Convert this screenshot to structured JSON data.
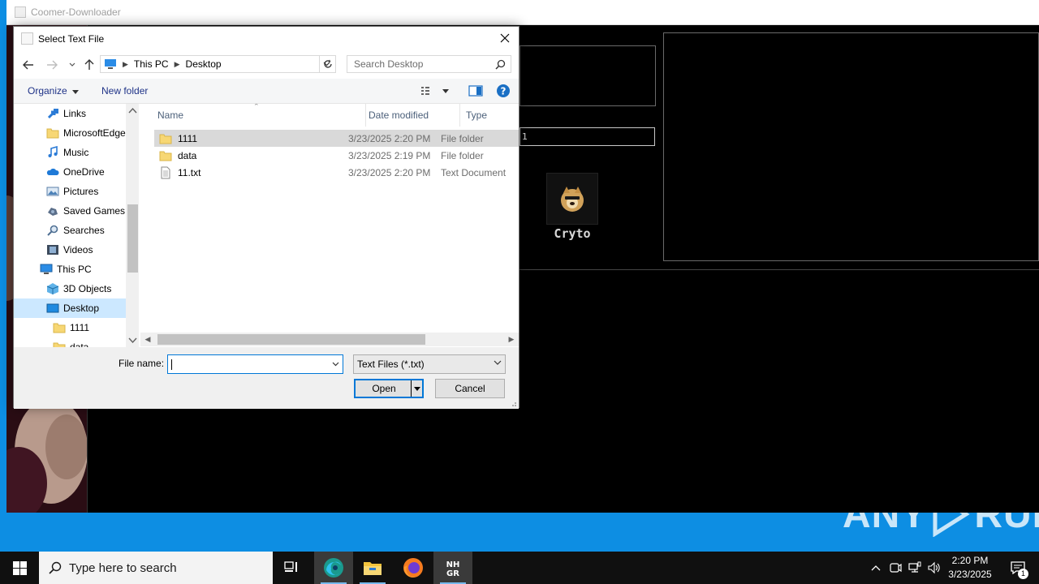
{
  "app": {
    "title": "Coomer-Downloader",
    "path_field_value": "1",
    "crypto_label": "Cryto"
  },
  "dialog": {
    "title": "Select Text File",
    "breadcrumb": [
      "This PC",
      "Desktop"
    ],
    "search_placeholder": "Search Desktop",
    "organize_label": "Organize",
    "new_folder_label": "New folder",
    "nav_items": [
      {
        "label": "Links",
        "icon": "links-icon"
      },
      {
        "label": "MicrosoftEdge",
        "icon": "folder-icon"
      },
      {
        "label": "Music",
        "icon": "music-icon"
      },
      {
        "label": "OneDrive",
        "icon": "cloud-icon"
      },
      {
        "label": "Pictures",
        "icon": "pictures-icon"
      },
      {
        "label": "Saved Games",
        "icon": "saved-games-icon"
      },
      {
        "label": "Searches",
        "icon": "search-icon"
      },
      {
        "label": "Videos",
        "icon": "videos-icon"
      },
      {
        "label": "This PC",
        "icon": "computer-icon"
      },
      {
        "label": "3D Objects",
        "icon": "3d-objects-icon"
      },
      {
        "label": "Desktop",
        "icon": "desktop-icon",
        "selected": true
      },
      {
        "label": "1111",
        "icon": "folder-icon"
      },
      {
        "label": "data",
        "icon": "folder-icon"
      }
    ],
    "columns": [
      "Name",
      "Date modified",
      "Type"
    ],
    "files": [
      {
        "name": "1111",
        "date": "3/23/2025 2:20 PM",
        "type": "File folder",
        "icon": "folder-icon",
        "selected": true
      },
      {
        "name": "data",
        "date": "3/23/2025 2:19 PM",
        "type": "File folder",
        "icon": "folder-icon"
      },
      {
        "name": "11.txt",
        "date": "3/23/2025 2:20 PM",
        "type": "Text Document",
        "icon": "text-file-icon"
      }
    ],
    "file_name_label": "File name:",
    "file_name_value": "",
    "file_type_value": "Text Files (*.txt)",
    "open_label": "Open",
    "cancel_label": "Cancel"
  },
  "taskbar": {
    "search_placeholder": "Type here to search",
    "time": "2:20 PM",
    "date": "3/23/2025",
    "notification_count": "1"
  },
  "watermark": {
    "left": "ANY",
    "right": "RUN"
  },
  "colors": {
    "desktop": "#0d8ee3",
    "accent": "#0078d7",
    "selection": "#cce8ff"
  }
}
